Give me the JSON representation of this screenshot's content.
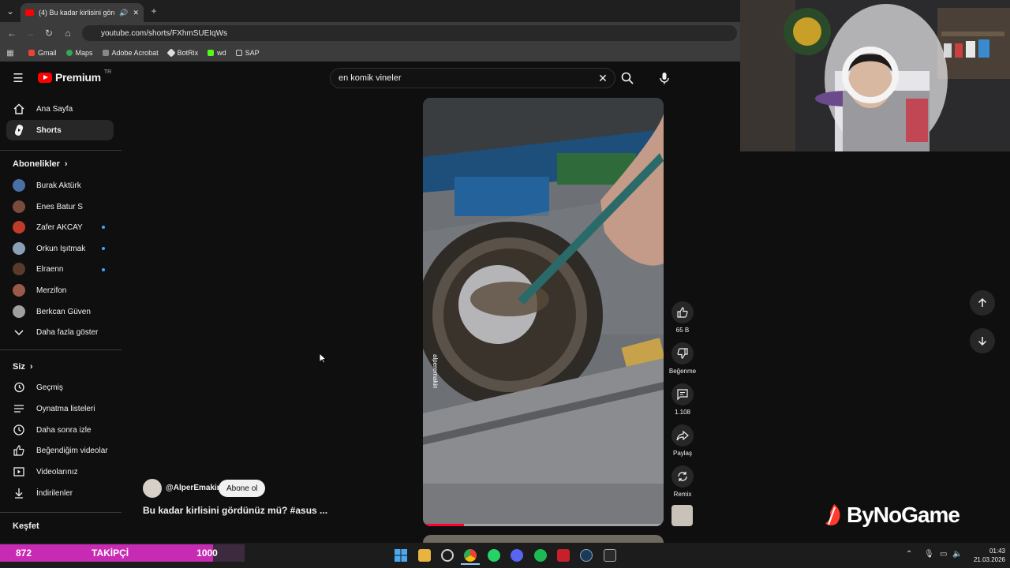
{
  "browser": {
    "tab_title": "(4) Bu kadar kirlisini gördünüz mü? #asus ...",
    "url": "youtube.com/shorts/FXhmSUEIqWs",
    "bookmarks": [
      "Gmail",
      "Maps",
      "Adobe Acrobat",
      "BotRix",
      "wd",
      "SAP"
    ]
  },
  "youtube": {
    "logo_text": "Premium",
    "region": "TR",
    "search_value": "en komik vineler"
  },
  "sidebar": {
    "top": [
      {
        "label": "Ana Sayfa",
        "icon": "home-icon"
      },
      {
        "label": "Shorts",
        "icon": "shorts-icon"
      }
    ],
    "subs_title": "Abonelikler",
    "subs": [
      {
        "label": "Burak Aktürk",
        "color": "#4a6fa5",
        "new": false
      },
      {
        "label": "Enes Batur S",
        "color": "#7a4a3a",
        "new": false
      },
      {
        "label": "Zafer AKCAY",
        "color": "#c23a2a",
        "new": true
      },
      {
        "label": "Orkun Işıtmak",
        "color": "#8aa0b8",
        "new": true
      },
      {
        "label": "Elraenn",
        "color": "#5a3a2a",
        "new": true
      },
      {
        "label": "Merzifon",
        "color": "#9a5a4a",
        "new": false
      },
      {
        "label": "Berkcan Güven",
        "color": "#a0a0a0",
        "new": false
      }
    ],
    "show_more": "Daha fazla göster",
    "you_title": "Siz",
    "you_items": [
      {
        "label": "Geçmiş",
        "icon": "history-icon"
      },
      {
        "label": "Oynatma listeleri",
        "icon": "playlist-icon"
      },
      {
        "label": "Daha sonra izle",
        "icon": "clock-icon"
      },
      {
        "label": "Beğendiğim videolar",
        "icon": "thumbs-up-icon"
      },
      {
        "label": "Videolarınız",
        "icon": "video-icon"
      },
      {
        "label": "İndirilenler",
        "icon": "download-icon"
      }
    ],
    "explore_title": "Keşfet"
  },
  "short": {
    "channel": "@AlperEmakin",
    "subscribe_label": "Abone ol",
    "title": "Bu kadar kirlisini gördünüz mü? #asus ...",
    "watermark": "alperemakin",
    "likes": "65 B",
    "dislike_label": "Beğenme",
    "comments": "1.108",
    "share_label": "Paylaş",
    "remix_label": "Remix",
    "progress": 0.17
  },
  "overlay": {
    "brand": "ByNoGame",
    "follow_current": "872",
    "follow_label": "TAKİPÇİ",
    "follow_goal": "1000",
    "follow_progress": 0.872
  },
  "taskbar": {
    "time": "01:43",
    "date": "21.03.2026"
  },
  "colors": {
    "accent": "#ff0000",
    "follow_bar": "#c72bb4",
    "unread_dot": "#3ea6ff"
  }
}
